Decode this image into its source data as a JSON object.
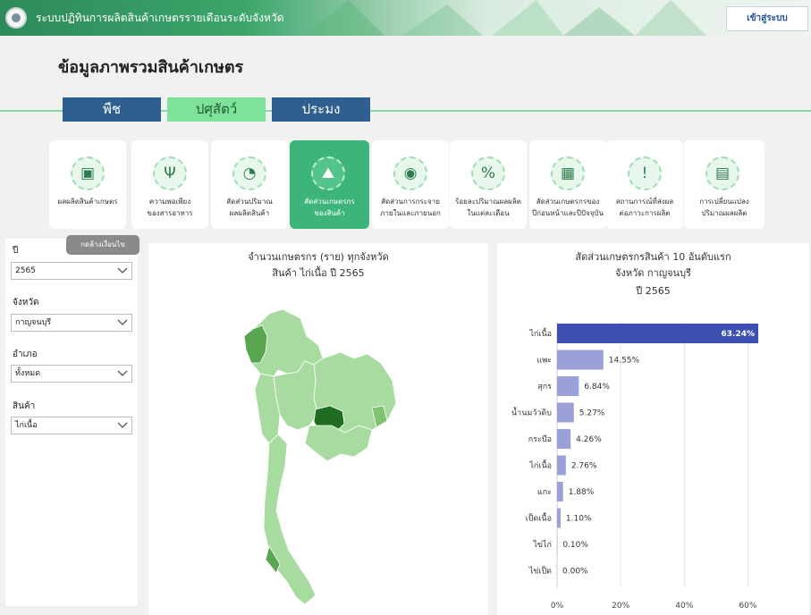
{
  "header": {
    "title": "ระบบปฏิทินการผลิตสินค้าเกษตรรายเดือนระดับจังหวัด",
    "login_label": "เข้าสู่ระบบ"
  },
  "page_title": "ข้อมูลภาพรวมสินค้าเกษตร",
  "tabs": [
    {
      "label": "พืช"
    },
    {
      "label": "ปศุสัตว์"
    },
    {
      "label": "ประมง"
    }
  ],
  "cards": [
    {
      "line1": "ผลผลิตสินค้าเกษตร",
      "line2": "",
      "icon": "box-icon",
      "glyph": "▣"
    },
    {
      "line1": "ความพอเพียง",
      "line2": "ของสารอาหาร",
      "icon": "fork-knife-icon",
      "glyph": "Ψ"
    },
    {
      "line1": "สัดส่วนปริมาณ",
      "line2": "ผลผลิตสินค้า",
      "icon": "pie-chart-icon",
      "glyph": "◔"
    },
    {
      "line1": "สัดส่วนเกษตรกร",
      "line2": "ของสินค้า",
      "icon": "farmer-icon",
      "glyph": "⛰"
    },
    {
      "line1": "สัดส่วนการกระจาย",
      "line2": "ภายในและภายนอก",
      "icon": "globe-pin-icon",
      "glyph": "◉"
    },
    {
      "line1": "ร้อยละปริมาณผลผลิต",
      "line2": "ในแต่ละเดือน",
      "icon": "percent-icon",
      "glyph": "%"
    },
    {
      "line1": "สัดส่วนเกษตรกรของ",
      "line2": "ปีก่อนหน้าและปีปัจจุบัน",
      "icon": "calendar-chart-icon",
      "glyph": "▦"
    },
    {
      "line1": "สถานการณ์ที่ส่งผล",
      "line2": "ต่อภาวะการผลิต",
      "icon": "chat-alert-icon",
      "glyph": "!"
    },
    {
      "line1": "การเปลี่ยนแปลง",
      "line2": "ปริมาณผลผลิต",
      "icon": "document-chart-icon",
      "glyph": "▤"
    }
  ],
  "filters": {
    "clear_label": "กดล้างเงื่อนไข",
    "year_label": "ปี",
    "year_value": "2565",
    "province_label": "จังหวัด",
    "province_value": "กาญจนบุรี",
    "district_label": "อำเภอ",
    "district_value": "ทั้งหมด",
    "product_label": "สินค้า",
    "product_value": "ไก่เนื้อ"
  },
  "map": {
    "title_line1": "จำนวนเกษตรกร (ราย) ทุกจังหวัด",
    "title_line2": "สินค้า ไก่เนื้อ ปี 2565"
  },
  "chart_panel": {
    "title_line1": "สัดส่วนเกษตรกรสินค้า 10 อันดับแรก",
    "title_line2": "จังหวัด กาญจนบุรี",
    "title_line3": "ปี 2565"
  },
  "chart_data": {
    "type": "bar",
    "orientation": "horizontal",
    "categories": [
      "ไก่เนื้อ",
      "แพะ",
      "สุกร",
      "น้ำนมวัวดิบ",
      "กระบือ",
      "ไก่เนื้อ",
      "แกะ",
      "เป็ดเนื้อ",
      "ไข่ไก่",
      "ไข่เป็ด"
    ],
    "values": [
      63.24,
      14.55,
      6.84,
      5.27,
      4.26,
      2.76,
      1.88,
      1.1,
      0.1,
      0.0
    ],
    "value_labels": [
      "63.24%",
      "14.55%",
      "6.84%",
      "5.27%",
      "4.26%",
      "2.76%",
      "1.88%",
      "1.10%",
      "0.10%",
      "0.00%"
    ],
    "xlim": [
      0,
      63.24
    ],
    "xticks": [
      0,
      20,
      40,
      60
    ],
    "xtick_labels": [
      "0%",
      "20%",
      "40%",
      "60%"
    ],
    "highlight_color": "#3d4fb3",
    "bar_color": "#9aa1d9"
  }
}
